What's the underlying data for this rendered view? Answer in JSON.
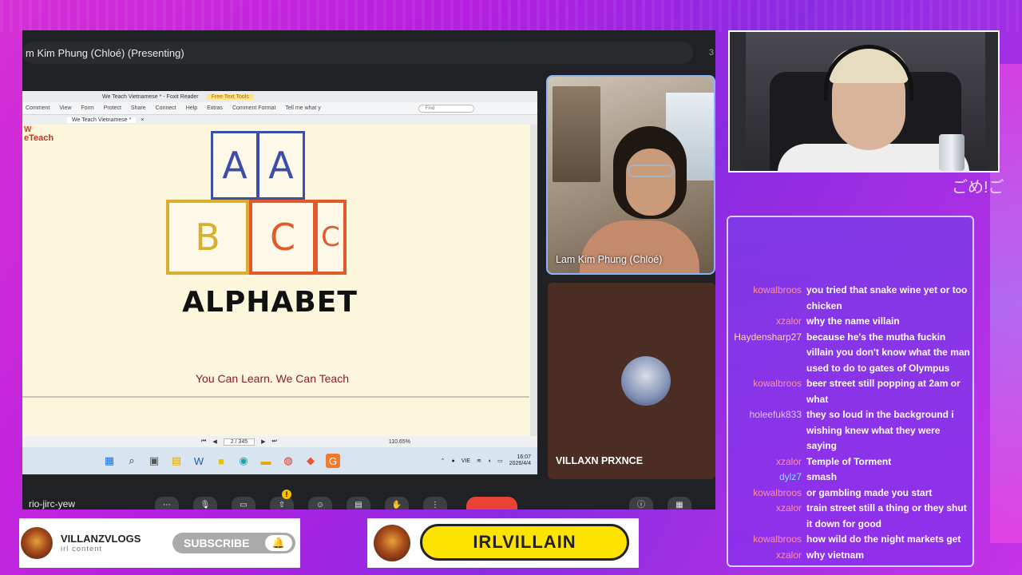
{
  "meet": {
    "presenter_title": "m Kim Phung (Chloé) (Presenting)",
    "people_count": "3",
    "meeting_code": "rio-jirc-yew",
    "mute_badge": "!"
  },
  "reader": {
    "window_title": "We Teach Vietnamese * - Foxit Reader",
    "tool_label": "Free Text Tools",
    "menu": [
      "Comment",
      "View",
      "Form",
      "Protect",
      "Share",
      "Connect",
      "Help",
      "Extras",
      "Comment Format"
    ],
    "tell_me": "Tell me what y",
    "find_placeholder": "Find",
    "tab_label": "We Teach Vietnamese *",
    "page_indicator": "2 / 345",
    "zoom": "110.65%",
    "time": "16:07",
    "date": "2026/4/4",
    "lang": "VIE"
  },
  "document": {
    "logo_mark": "W",
    "logo_text": "eTeach",
    "blocks": [
      {
        "letter": "A",
        "color": "#3b4fa8"
      },
      {
        "letter": "A",
        "color": "#3b4fa8"
      },
      {
        "letter": "B",
        "color": "#d8b030"
      },
      {
        "letter": "C",
        "color": "#e05a2a"
      },
      {
        "letter": "C",
        "color": "#e05a2a"
      }
    ],
    "title": "ALPHABET",
    "tagline": "You Can Learn. We Can Teach"
  },
  "participants": {
    "chloe_name": "Lam Kim Phung (Chloé)",
    "villain_name": "VILLAXN PRXNCE"
  },
  "webcam": {
    "deco_text": "ごめ!ご"
  },
  "chat": [
    {
      "user": "kowalbroos",
      "color": "#ff8fa3",
      "text": "you tried that snake wine yet or too chicken"
    },
    {
      "user": "xzalor",
      "color": "#ff8fa3",
      "text": "why the name villain"
    },
    {
      "user": "Haydensharp27",
      "color": "#ffd7a8",
      "text": "because he's the mutha fuckin villain you don't know what the man used to do to gates of Olympus"
    },
    {
      "user": "kowalbroos",
      "color": "#ff8fa3",
      "text": "beer street still popping at 2am or what"
    },
    {
      "user": "holeefuk833",
      "color": "#d7c8ff",
      "text": "they so loud in the background i wishing knew what they were saying"
    },
    {
      "user": "xzalor",
      "color": "#ff8fa3",
      "text": "Temple of Torment"
    },
    {
      "user": "dylz7",
      "color": "#7fe3ff",
      "text": "smash"
    },
    {
      "user": "kowalbroos",
      "color": "#ff8fa3",
      "text": "or gambling made you start"
    },
    {
      "user": "xzalor",
      "color": "#ff8fa3",
      "text": "train street still a thing or they shut it down for good"
    },
    {
      "user": "kowalbroos",
      "color": "#ff8fa3",
      "text": "how wild do the night markets get"
    },
    {
      "user": "xzalor",
      "color": "#ff8fa3",
      "text": "why vietnam"
    }
  ],
  "subscribe_banner": {
    "channel": "VILLANZVLOGS",
    "tagline": "irl content",
    "button": "SUBSCRIBE",
    "bell_icon": "bell-icon"
  },
  "name_banner": {
    "handle": "IRLVILLAIN"
  }
}
